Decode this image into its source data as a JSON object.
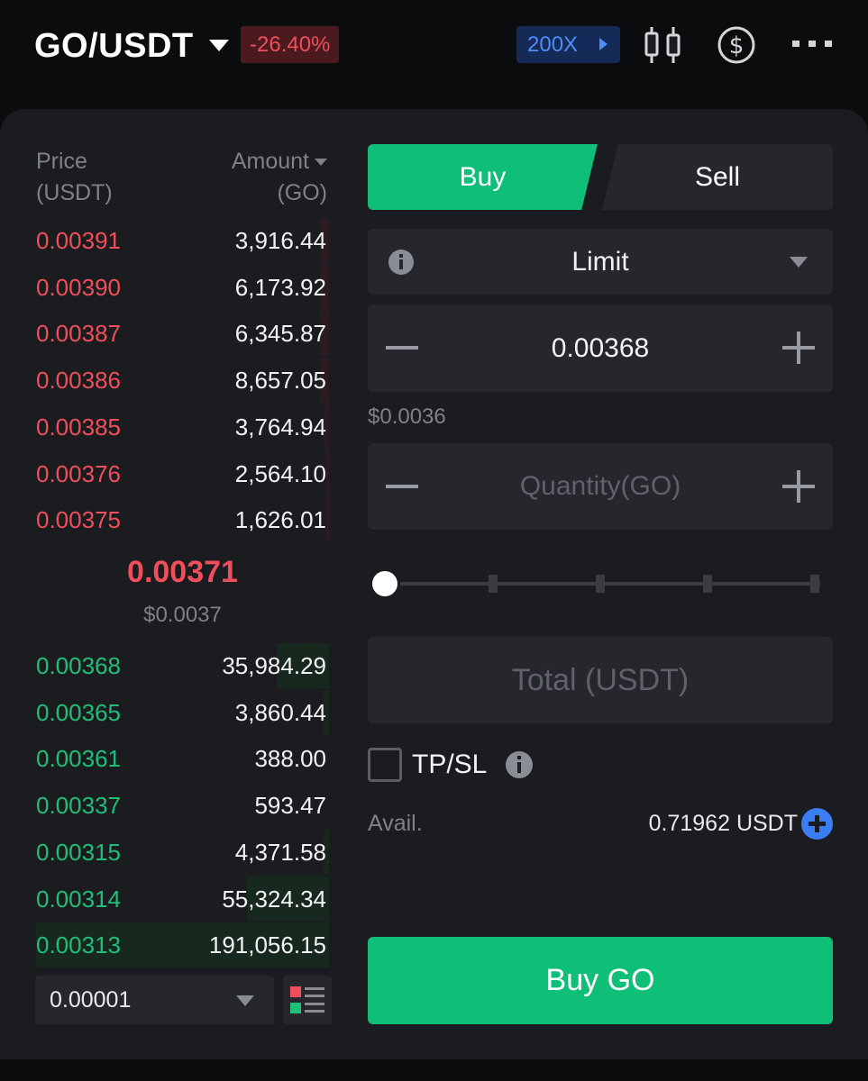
{
  "header": {
    "pair": "GO/USDT",
    "change": "-26.40%",
    "leverage": "200X",
    "icons": [
      "candlestick-chart-icon",
      "dollar-coin-icon",
      "more-icon"
    ]
  },
  "orderbook": {
    "price_header": [
      "Price",
      "(USDT)"
    ],
    "amount_header": [
      "Amount",
      "(GO)"
    ],
    "asks": [
      {
        "price": "0.00391",
        "amount": "3,916.44",
        "depth": 0.03
      },
      {
        "price": "0.00390",
        "amount": "6,173.92",
        "depth": 0.03
      },
      {
        "price": "0.00387",
        "amount": "6,345.87",
        "depth": 0.03
      },
      {
        "price": "0.00386",
        "amount": "8,657.05",
        "depth": 0.03
      },
      {
        "price": "0.00385",
        "amount": "3,764.94",
        "depth": 0.02
      },
      {
        "price": "0.00376",
        "amount": "2,564.10",
        "depth": 0.01
      },
      {
        "price": "0.00375",
        "amount": "1,626.01",
        "depth": 0.01
      }
    ],
    "mid_price": "0.00371",
    "mid_usd": "$0.0037",
    "bids": [
      {
        "price": "0.00368",
        "amount": "35,984.29",
        "depth": 0.18
      },
      {
        "price": "0.00365",
        "amount": "3,860.44",
        "depth": 0.02
      },
      {
        "price": "0.00361",
        "amount": "388.00",
        "depth": 0.0
      },
      {
        "price": "0.00337",
        "amount": "593.47",
        "depth": 0.0
      },
      {
        "price": "0.00315",
        "amount": "4,371.58",
        "depth": 0.02
      },
      {
        "price": "0.00314",
        "amount": "55,324.34",
        "depth": 0.28
      },
      {
        "price": "0.00313",
        "amount": "191,056.15",
        "depth": 1.0
      }
    ],
    "precision": "0.00001"
  },
  "order_form": {
    "buy_tab": "Buy",
    "sell_tab": "Sell",
    "order_type": "Limit",
    "price_value": "0.00368",
    "price_usd": "$0.0036",
    "quantity_placeholder": "Quantity(GO)",
    "slider_percent": 0,
    "total_placeholder": "Total (USDT)",
    "tpsl_label": "TP/SL",
    "tpsl_checked": false,
    "avail_label": "Avail.",
    "avail_value": "0.71962 USDT",
    "submit_label": "Buy GO"
  },
  "colors": {
    "buy": "#0fbf77",
    "sell": "#ef4e5a",
    "accent": "#3b7ef3",
    "panel": "#1b1c20"
  }
}
